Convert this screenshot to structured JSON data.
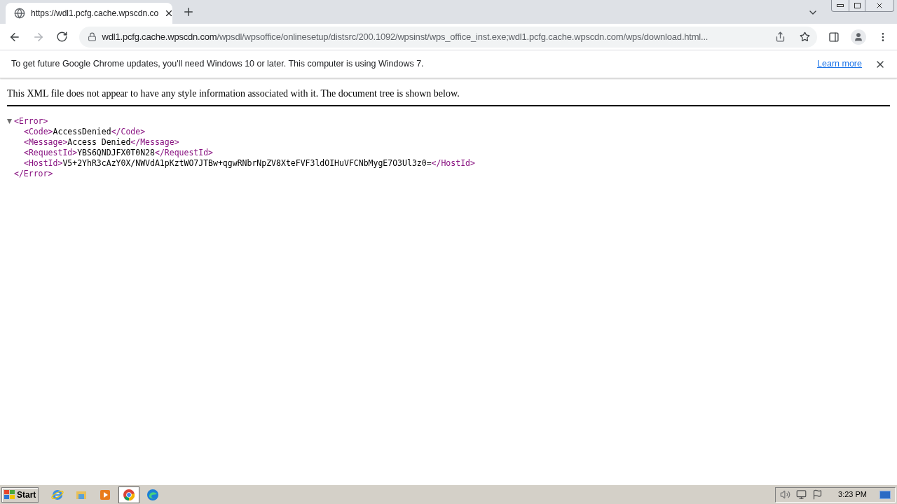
{
  "tab": {
    "title": "https://wdl1.pcfg.cache.wpscdn.co",
    "selected": true
  },
  "address": {
    "host": "wdl1.pcfg.cache.wpscdn.com",
    "path": "/wpsdl/wpsoffice/onlinesetup/distsrc/200.1092/wpsinst/wps_office_inst.exe;wdl1.pcfg.cache.wpscdn.com/wps/download.html..."
  },
  "infobar": {
    "message": "To get future Google Chrome updates, you'll need Windows 10 or later. This computer is using Windows 7.",
    "link": "Learn more"
  },
  "xml_notice": "This XML file does not appear to have any style information associated with it. The document tree is shown below.",
  "xml_tree": {
    "open": "<Error>",
    "expanded": true,
    "children": [
      {
        "open": "<Code>",
        "text": "AccessDenied",
        "close": "</Code>"
      },
      {
        "open": "<Message>",
        "text": "Access Denied",
        "close": "</Message>"
      },
      {
        "open": "<RequestId>",
        "text": "YBS6QNDJFX0T0N28",
        "close": "</RequestId>"
      },
      {
        "open": "<HostId>",
        "text": "V5+2YhR3cAzY0X/NWVdA1pKztWO7JTBw+qgwRNbrNpZV8XteFVF3ldOIHuVFCNbMygE7O3Ul3z0=",
        "close": "</HostId>"
      }
    ],
    "close": "</Error>"
  },
  "taskbar": {
    "start": "Start",
    "apps": [
      {
        "kind": "ie",
        "selected": false
      },
      {
        "kind": "explorer",
        "selected": false
      },
      {
        "kind": "media",
        "selected": false
      },
      {
        "kind": "chrome",
        "selected": true
      },
      {
        "kind": "edge",
        "selected": false
      }
    ],
    "clock": "3:23 PM"
  }
}
